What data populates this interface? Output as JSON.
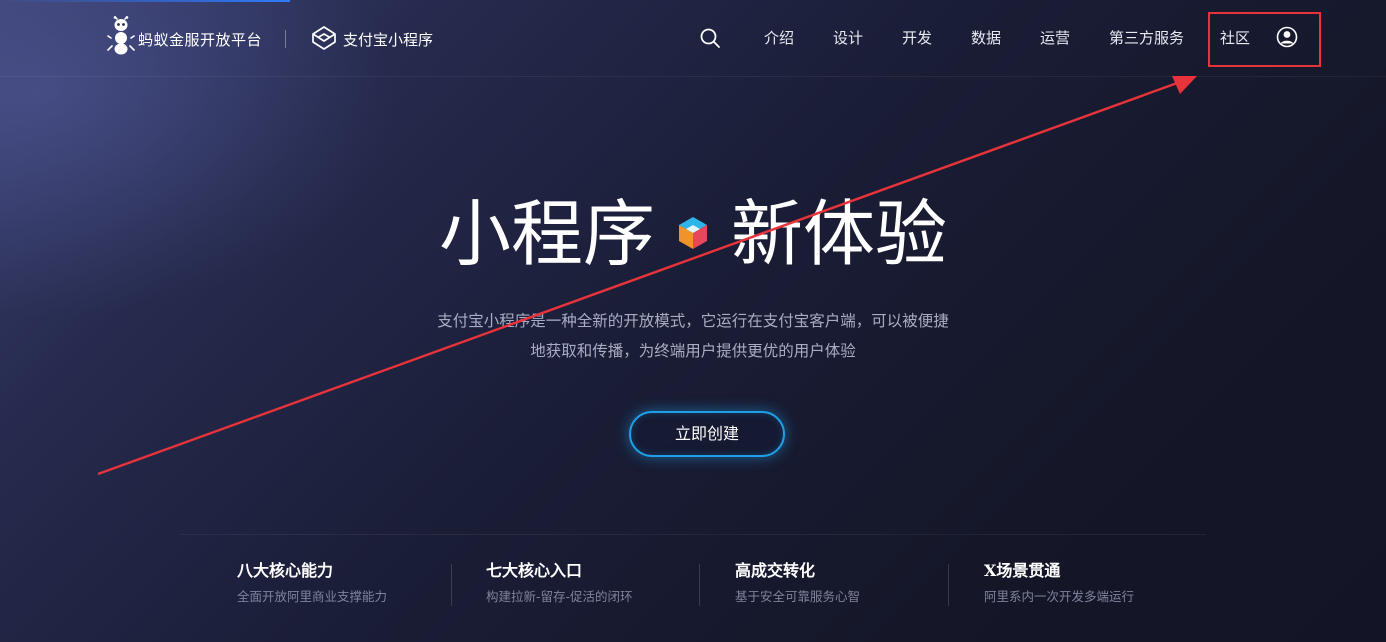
{
  "header": {
    "brand": "蚂蚁金服开放平台",
    "product": "支付宝小程序",
    "nav": [
      {
        "label": "介绍"
      },
      {
        "label": "设计"
      },
      {
        "label": "开发"
      },
      {
        "label": "数据"
      },
      {
        "label": "运营"
      },
      {
        "label": "第三方服务"
      },
      {
        "label": "社区"
      }
    ],
    "icons": {
      "search": "search-icon",
      "user": "user-avatar-icon",
      "logo": "ant-logo-icon",
      "product_logo": "mini-program-logo-icon"
    }
  },
  "hero": {
    "title_left": "小程序",
    "title_right": "新体验",
    "description_line1": "支付宝小程序是一种全新的开放模式，它运行在支付宝客户端，可以被便捷",
    "description_line2": "地获取和传播，为终端用户提供更优的用户体验",
    "cta_label": "立即创建"
  },
  "features": [
    {
      "title": "八大核心能力",
      "subtitle": "全面开放阿里商业支撑能力"
    },
    {
      "title": "七大核心入口",
      "subtitle": "构建拉新-留存-促活的闭环"
    },
    {
      "title": "高成交转化",
      "subtitle": "基于安全可靠服务心智"
    },
    {
      "title": "X场景贯通",
      "subtitle": "阿里系内一次开发多端运行"
    }
  ],
  "colors": {
    "accent": "#1e9fe8",
    "annotation": "#e8333a",
    "background": "#15182b"
  }
}
